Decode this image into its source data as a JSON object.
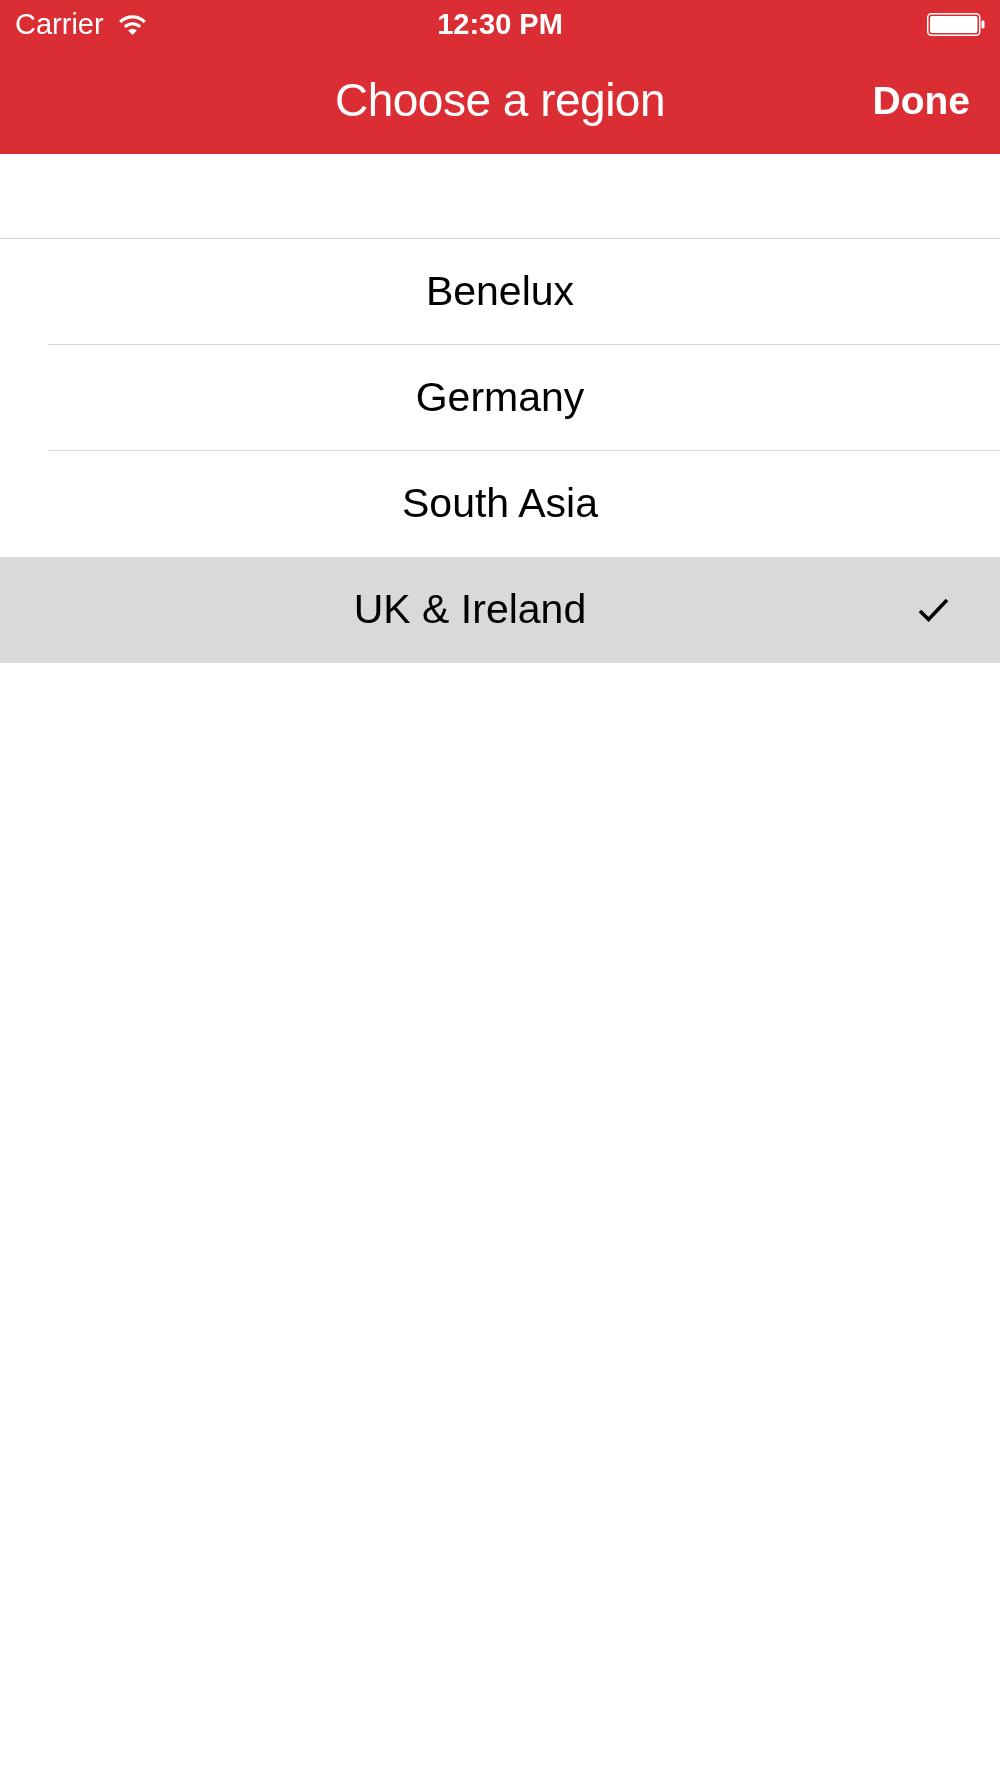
{
  "status_bar": {
    "carrier": "Carrier",
    "time": "12:30 PM"
  },
  "nav_bar": {
    "title": "Choose a region",
    "done_button": "Done"
  },
  "regions": [
    {
      "name": "Benelux",
      "selected": false
    },
    {
      "name": "Germany",
      "selected": false
    },
    {
      "name": "South Asia",
      "selected": false
    },
    {
      "name": "UK & Ireland",
      "selected": true
    }
  ]
}
